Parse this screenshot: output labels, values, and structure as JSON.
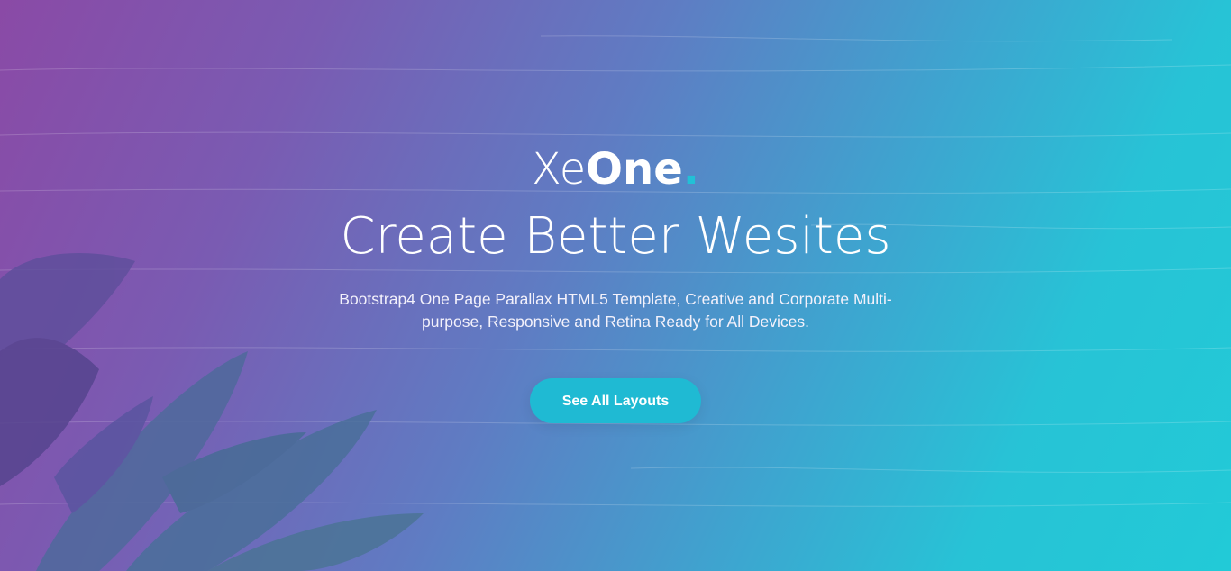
{
  "hero": {
    "brand_light": "Xe",
    "brand_bold": "One",
    "brand_dot": ".",
    "headline": "Create Better Wesites",
    "subtitle": "Bootstrap4 One Page Parallax HTML5 Template, Creative and Corporate Multi-purpose, Responsive and Retina Ready for All Devices.",
    "cta_label": "See All Layouts"
  },
  "colors": {
    "gradient_start": "#8a4aa6",
    "gradient_end": "#22cad7",
    "accent": "#1fbad3"
  }
}
